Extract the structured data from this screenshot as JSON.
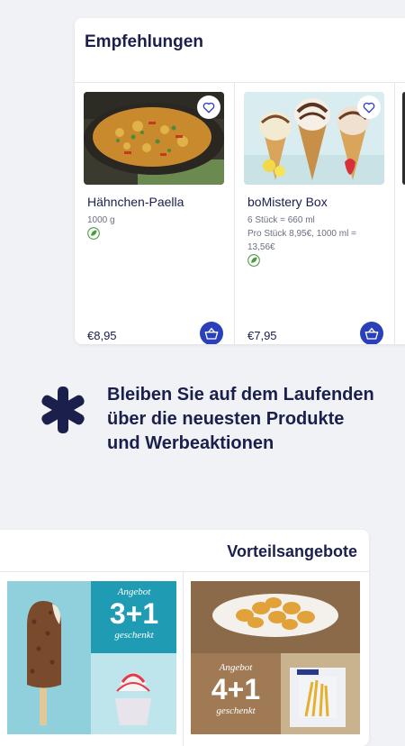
{
  "empfehlungen": {
    "title": "Empfehlungen",
    "products": [
      {
        "name": "Hähnchen-Paella",
        "meta": [
          "1000 g"
        ],
        "price": "€8,95"
      },
      {
        "name": "boMistery Box",
        "meta": [
          "6 Stück = 660 ml",
          "Pro Stück 8,95€, 1000 ml = 13,56€"
        ],
        "price": "€7,95"
      }
    ]
  },
  "promo": {
    "text": "Bleiben Sie auf dem Laufenden über die neuesten Produkte und Werbeaktionen"
  },
  "vorteilsangebote": {
    "title": "Vorteilsangebote",
    "offers": [
      {
        "badge_top": "Angebot",
        "badge_main": "3+1",
        "badge_bottom": "geschenkt"
      },
      {
        "badge_top": "Angebot",
        "badge_main": "4+1",
        "badge_bottom": "geschenkt"
      }
    ]
  },
  "icons": {
    "favorite": "heart-icon",
    "cart": "basket-icon",
    "vegan": "leaf-icon",
    "promo": "asterisk-icon"
  },
  "colors": {
    "accent": "#2a40b8",
    "text": "#1a1f4c",
    "leaf": "#4a9a3e",
    "background": "#f1f2f5",
    "offer_teal": "#1f9bb4",
    "offer_brown": "#8b6a4a"
  }
}
